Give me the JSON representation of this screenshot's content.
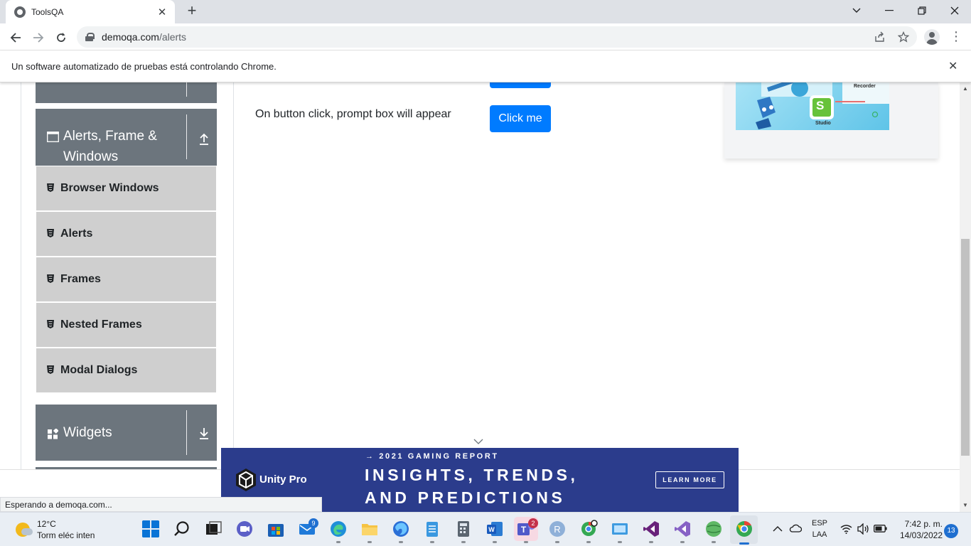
{
  "browser": {
    "tab_title": "ToolsQA",
    "url_host": "demoqa.com",
    "url_path": "/alerts",
    "infobar_message": "Un software automatizado de pruebas está controlando Chrome.",
    "status_text": "Esperando a demoqa.com..."
  },
  "sidebar": {
    "group_alerts": {
      "label_line1": "Alerts, Frame &",
      "label_line2": "Windows"
    },
    "items": [
      {
        "label": "Browser Windows"
      },
      {
        "label": "Alerts"
      },
      {
        "label": "Frames"
      },
      {
        "label": "Nested Frames"
      },
      {
        "label": "Modal Dialogs"
      }
    ],
    "group_widgets": {
      "label": "Widgets"
    }
  },
  "main": {
    "prompt_text": "On button click, prompt box will appear",
    "prompt_button": "Click me"
  },
  "ad_card": {
    "recorder_label": "Recorder",
    "studio_label": "Studio",
    "logo_letter": "S"
  },
  "banner": {
    "brand": "Unity Pro",
    "kicker": "→ 2021 GAMING REPORT",
    "headline_line1": "INSIGHTS, TRENDS,",
    "headline_line2": "AND PREDICTIONS",
    "cta": "LEARN MORE",
    "background_color": "#2b3c8c"
  },
  "taskbar": {
    "weather_temp": "12°C",
    "weather_desc": "Torm eléc inten",
    "mail_badge": "9",
    "teams_badge": "2",
    "lang_top": "ESP",
    "lang_bottom": "LAA",
    "time": "7:42 p. m.",
    "date": "14/03/2022",
    "notifications": "13"
  },
  "colors": {
    "sidebar_group": "#6c757d",
    "sidebar_item": "#cfcfcf",
    "primary_button": "#007bff"
  }
}
